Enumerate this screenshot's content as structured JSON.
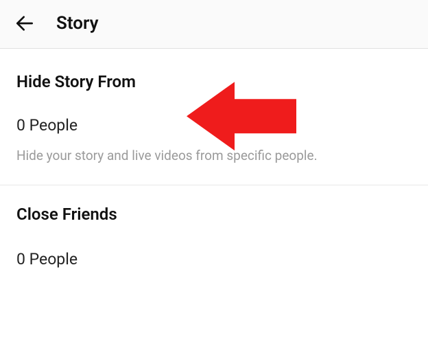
{
  "header": {
    "title": "Story"
  },
  "sections": {
    "hide_story": {
      "title": "Hide Story From",
      "value": "0 People",
      "description": "Hide your story and live videos from specific people."
    },
    "close_friends": {
      "title": "Close Friends",
      "value": "0 People"
    }
  },
  "annotation": {
    "arrow_color": "#ef1c1c"
  }
}
